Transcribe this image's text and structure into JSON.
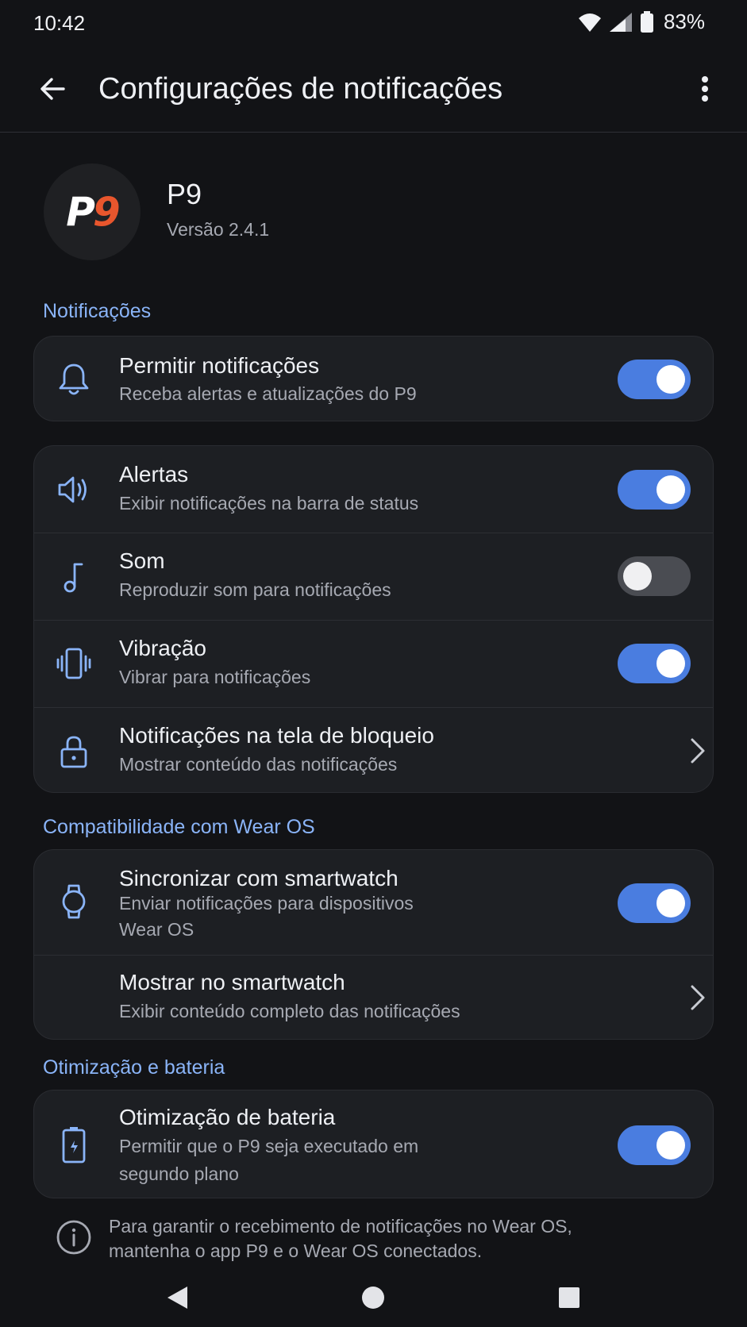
{
  "status_bar": {
    "time": "10:42",
    "battery": "83%"
  },
  "app_bar": {
    "title": "Configurações de notificações"
  },
  "app": {
    "name": "P9",
    "version": "Versão 2.4.1",
    "logo_text_p": "P",
    "logo_text_9": "9"
  },
  "colors": {
    "accent": "#8ab4f8",
    "toggle_on": "#4a7de0",
    "background": "#121316",
    "card": "#1d1f23",
    "logo_red": "#e8562d"
  },
  "sections": {
    "notifications": {
      "title": "Notificações",
      "allow": {
        "title": "Permitir notificações",
        "subtitle": "Receba alertas e atualizações do P9",
        "enabled": true,
        "icon": "bell-icon"
      },
      "alerts": {
        "title": "Alertas",
        "subtitle": "Exibir notificações na barra de status",
        "enabled": true,
        "icon": "speaker-icon"
      },
      "sound": {
        "title": "Som",
        "subtitle": "Reproduzir som para notificações",
        "enabled": false,
        "icon": "music-note-icon"
      },
      "vibration": {
        "title": "Vibração",
        "subtitle": "Vibrar para notificações",
        "enabled": true,
        "icon": "vibrate-icon"
      },
      "lockscreen": {
        "title": "Notificações na tela de bloqueio",
        "subtitle": "Mostrar conteúdo das notificações",
        "icon": "lock-icon"
      }
    },
    "wear_os": {
      "title": "Compatibilidade com Wear OS",
      "sync": {
        "title": "Sincronizar com smartwatch",
        "subtitle_line1": "Enviar notificações para dispositivos",
        "subtitle_line2": "Wear OS",
        "enabled": true,
        "icon": "watch-icon"
      },
      "show": {
        "title": "Mostrar no smartwatch",
        "subtitle": "Exibir conteúdo completo das notificações"
      }
    },
    "battery": {
      "title": "Otimização e bateria",
      "optimization": {
        "title": "Otimização de bateria",
        "subtitle_line1": "Permitir que o P9 seja executado em",
        "subtitle_line2": "segundo plano",
        "enabled": true,
        "icon": "battery-icon"
      }
    }
  },
  "footer": {
    "info_line1": "Para garantir o recebimento de notificações no Wear OS,",
    "info_line2": "mantenha o app P9 e o Wear OS conectados."
  }
}
